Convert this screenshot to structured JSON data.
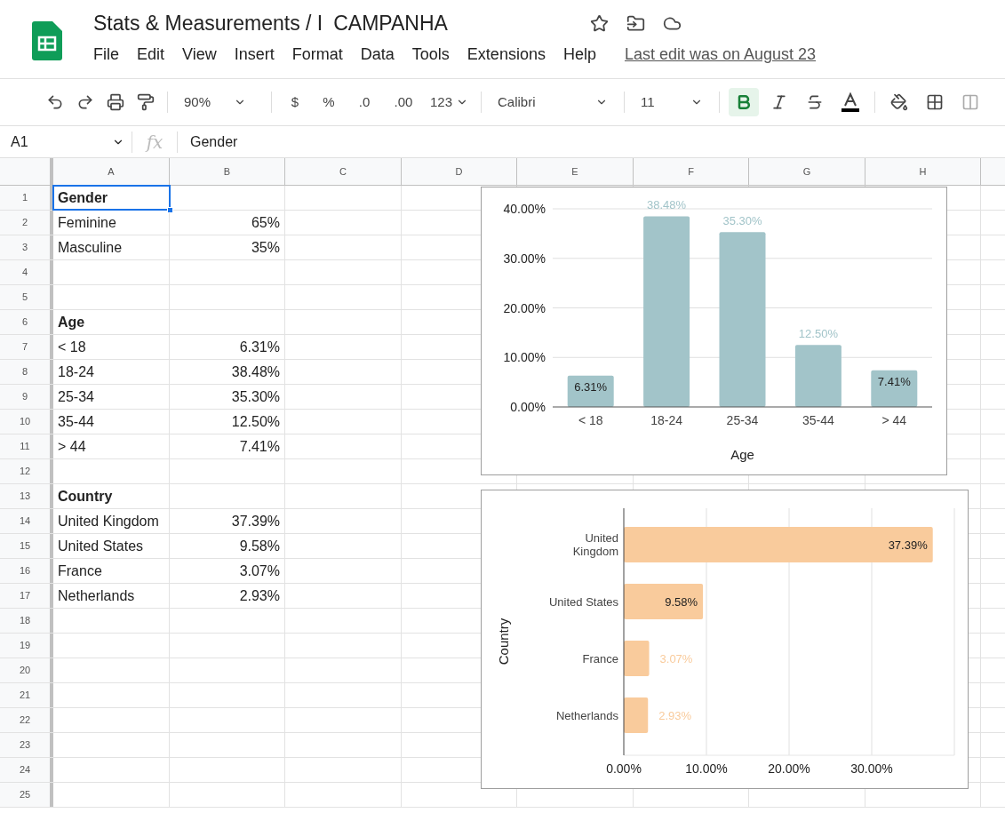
{
  "document": {
    "title": "Stats & Measurements / I",
    "title_field": "CAMPANHA",
    "last_edit": "Last edit was on August 23"
  },
  "menu": [
    "File",
    "Edit",
    "View",
    "Insert",
    "Format",
    "Data",
    "Tools",
    "Extensions",
    "Help"
  ],
  "toolbar": {
    "zoom": "90%",
    "currency": "$",
    "percent": "%",
    "decrease_decimals": ".0",
    "increase_decimals": ".00",
    "number_format": "123",
    "font": "Calibri",
    "font_size": "11",
    "bold_on": true
  },
  "formula_bar": {
    "cell_ref": "A1",
    "fx": "fx",
    "value": "Gender"
  },
  "columns": [
    "A",
    "B",
    "C",
    "D",
    "E",
    "F",
    "G",
    "H"
  ],
  "rows": [
    {
      "number": "1",
      "cells": [
        {
          "text": "Gender",
          "bold": true,
          "selected": true
        }
      ]
    },
    {
      "number": "2",
      "cells": [
        {
          "text": "Feminine",
          "bold": false,
          "selected": false
        },
        {
          "text": "65%",
          "bold": false,
          "selected": false
        }
      ]
    },
    {
      "number": "3",
      "cells": [
        {
          "text": "Masculine",
          "bold": false,
          "selected": false
        },
        {
          "text": "35%",
          "bold": false,
          "selected": false
        }
      ]
    },
    {
      "number": "4"
    },
    {
      "number": "5"
    },
    {
      "number": "6",
      "cells": [
        {
          "text": "Age",
          "bold": true,
          "selected": false
        }
      ]
    },
    {
      "number": "7",
      "cells": [
        {
          "text": "< 18",
          "bold": false,
          "selected": false
        },
        {
          "text": "6.31%",
          "bold": false,
          "selected": false
        }
      ]
    },
    {
      "number": "8",
      "cells": [
        {
          "text": "18-24",
          "bold": false,
          "selected": false
        },
        {
          "text": "38.48%",
          "bold": false,
          "selected": false
        }
      ]
    },
    {
      "number": "9",
      "cells": [
        {
          "text": "25-34",
          "bold": false,
          "selected": false
        },
        {
          "text": "35.30%",
          "bold": false,
          "selected": false
        }
      ]
    },
    {
      "number": "10",
      "cells": [
        {
          "text": "35-44",
          "bold": false,
          "selected": false
        },
        {
          "text": "12.50%",
          "bold": false,
          "selected": false
        }
      ]
    },
    {
      "number": "11",
      "cells": [
        {
          "text": "> 44",
          "bold": false,
          "selected": false
        },
        {
          "text": "7.41%",
          "bold": false,
          "selected": false
        }
      ]
    },
    {
      "number": "12"
    },
    {
      "number": "13",
      "cells": [
        {
          "text": "Country",
          "bold": true,
          "selected": false
        }
      ]
    },
    {
      "number": "14",
      "cells": [
        {
          "text": "United Kingdom",
          "bold": false,
          "selected": false
        },
        {
          "text": "37.39%",
          "bold": false,
          "selected": false
        }
      ]
    },
    {
      "number": "15",
      "cells": [
        {
          "text": "United States",
          "bold": false,
          "selected": false
        },
        {
          "text": "9.58%",
          "bold": false,
          "selected": false
        }
      ]
    },
    {
      "number": "16",
      "cells": [
        {
          "text": "France",
          "bold": false,
          "selected": false
        },
        {
          "text": "3.07%",
          "bold": false,
          "selected": false
        }
      ]
    },
    {
      "number": "17",
      "cells": [
        {
          "text": "Netherlands",
          "bold": false,
          "selected": false
        },
        {
          "text": "2.93%",
          "bold": false,
          "selected": false
        }
      ]
    },
    {
      "number": "18"
    },
    {
      "number": "19"
    },
    {
      "number": "20"
    },
    {
      "number": "21"
    },
    {
      "number": "22"
    },
    {
      "number": "23"
    },
    {
      "number": "24"
    },
    {
      "number": "25"
    }
  ],
  "charts": [
    {
      "chart_data": {
        "type": "bar",
        "orientation": "vertical",
        "xlabel": "Age",
        "categories": [
          "< 18",
          "18-24",
          "25-34",
          "35-44",
          "> 44"
        ],
        "series": [
          {
            "color": "#a2c4c9",
            "values": [
              6.31,
              38.48,
              35.3,
              12.5,
              7.41
            ]
          }
        ],
        "ylim": [
          0,
          40
        ],
        "yticks": [
          {
            "value": 0,
            "label": "0.00%"
          },
          {
            "value": 10,
            "label": "10.00%"
          },
          {
            "value": 20,
            "label": "20.00%"
          },
          {
            "value": 30,
            "label": "30.00%"
          },
          {
            "value": 40,
            "label": "40.00%"
          }
        ],
        "grid": true,
        "value_labels": [
          "6.31%",
          "38.48%",
          "35.30%",
          "12.50%",
          "7.41%"
        ]
      }
    },
    {
      "chart_data": {
        "type": "bar",
        "orientation": "horizontal",
        "ylabel": "Country",
        "categories": [
          "United Kingdom",
          "United States",
          "France",
          "Netherlands"
        ],
        "series": [
          {
            "color": "#f9cb9c",
            "values": [
              37.39,
              9.58,
              3.07,
              2.93
            ]
          }
        ],
        "xlim": [
          0,
          40
        ],
        "xticks": [
          {
            "value": 0,
            "label": "0.00%"
          },
          {
            "value": 10,
            "label": "10.00%"
          },
          {
            "value": 20,
            "label": "20.00%"
          },
          {
            "value": 30,
            "label": "30.00%"
          }
        ],
        "grid": true,
        "value_labels": [
          "37.39%",
          "9.58%",
          "3.07%",
          "2.93%"
        ]
      }
    }
  ]
}
